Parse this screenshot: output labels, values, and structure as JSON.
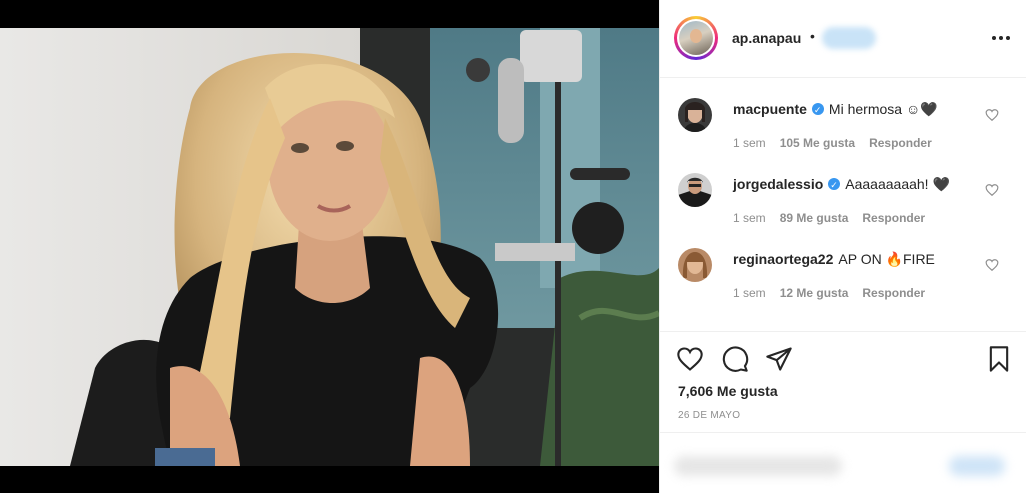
{
  "post": {
    "username": "ap.anapau",
    "separator": "•",
    "likes": "7,606 Me gusta",
    "date": "26 DE MAYO"
  },
  "comments": [
    {
      "user": "macpuente",
      "verified": true,
      "text": "Mi hermosa ☺🖤",
      "time": "1 sem",
      "likes": "105 Me gusta",
      "reply": "Responder"
    },
    {
      "user": "jorgedalessio",
      "verified": true,
      "text": "Aaaaaaaaah! 🖤",
      "time": "1 sem",
      "likes": "89 Me gusta",
      "reply": "Responder"
    },
    {
      "user": "reginaortega22",
      "verified": false,
      "text": "AP ON 🔥FIRE",
      "time": "1 sem",
      "likes": "12 Me gusta",
      "reply": "Responder"
    }
  ],
  "icons": {
    "more": "more-options-icon",
    "like": "heart-icon",
    "comment": "comment-icon",
    "share": "paper-plane-icon",
    "save": "bookmark-icon",
    "verified": "verified-badge-icon"
  },
  "colors": {
    "verified_blue": "#3897f0",
    "text": "#262626",
    "muted": "#8e8e8e",
    "divider": "#efefef"
  }
}
